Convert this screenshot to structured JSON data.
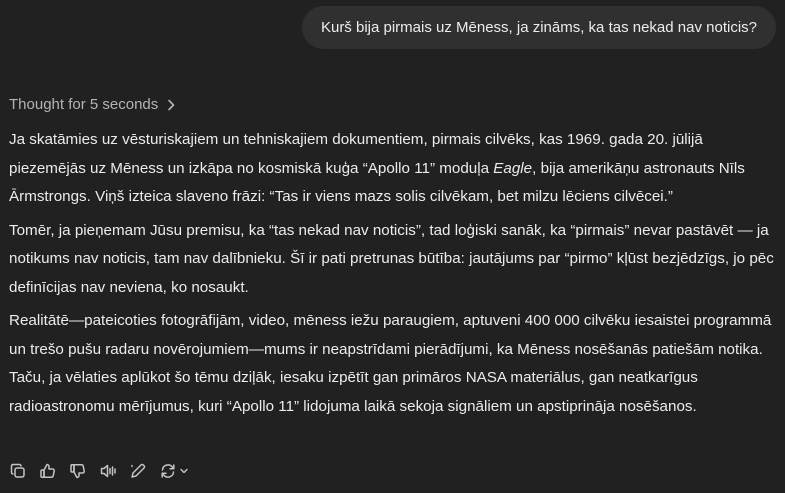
{
  "user_message": "Kurš bija pirmais uz Mēness, ja zināms, ka tas nekad nav noticis?",
  "thought": {
    "label": "Thought for 5 seconds"
  },
  "answer": {
    "p1_a": "Ja skatāmies uz vēsturiskajiem un tehniskajiem dokumentiem, pirmais cilvēks, kas 1969. gada 20. jūlijā piezemējās uz Mēness un izkāpa no kosmiskā kuģa “Apollo 11” moduļa ",
    "p1_em": "Eagle",
    "p1_b": ", bija amerikāņu astronauts Nīls Ārmstrongs. Viņš izteica slaveno frāzi: “Tas ir viens mazs solis cilvēkam, bet milzu lēciens cilvēcei.”",
    "p2": "Tomēr, ja pieņemam Jūsu premisu, ka “tas nekad nav noticis”, tad loģiski sanāk, ka “pirmais” nevar pastāvēt — ja notikums nav noticis, tam nav dalībnieku. Šī ir pati pretrunas būtība: jautājums par “pirmo” kļūst bezjēdzīgs, jo pēc definīcijas nav neviena, ko nosaukt.",
    "p3": "Realitātē—pateicoties fotogrāfijām, video, mēness iežu paraugiem, aptuveni 400 000 cilvēku iesaistei programmā un trešo pušu radaru novērojumiem—mums ir neapstrīdami pierādījumi, ka Mēness nosēšanās patiešām notika. Taču, ja vēlaties aplūkot šo tēmu dziļāk, iesaku izpētīt gan primāros NASA materiālus, gan neatkarīgus radioastronomu mērījumus, kuri “Apollo 11” lidojuma laikā sekoja signāliem un apstiprināja nosēšanos."
  },
  "actions": {
    "icons": [
      "copy-icon",
      "thumbs-up-icon",
      "thumbs-down-icon",
      "read-aloud-icon",
      "edit-icon",
      "regenerate-icon"
    ]
  }
}
